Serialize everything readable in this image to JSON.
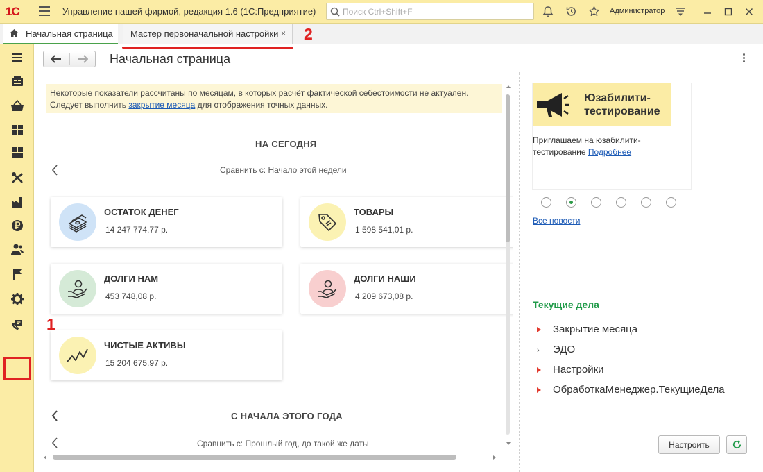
{
  "window": {
    "logo": "1С",
    "title": "Управление нашей фирмой, редакция 1.6  (1С:Предприятие)",
    "search_placeholder": "Поиск Ctrl+Shift+F",
    "user": "Администратор"
  },
  "tabs": [
    {
      "label": "Начальная страница",
      "active": true
    },
    {
      "label": "Мастер первоначальной настройки",
      "close": "×"
    }
  ],
  "annotations": {
    "one": "1",
    "two": "2"
  },
  "page": {
    "title": "Начальная страница"
  },
  "warning": {
    "text1": "Некоторые показатели рассчитаны по месяцам, в которых расчёт фактической себестоимости не актуален.",
    "text2_before": "Следует выполнить ",
    "link": "закрытие месяца",
    "text2_after": " для отображения точных данных."
  },
  "today": {
    "title": "НА СЕГОДНЯ",
    "compare": "Сравнить с: Начало этой недели",
    "cards": [
      {
        "title": "ОСТАТОК ДЕНЕГ",
        "value": "14 247 774,77 р.",
        "color": "#cfe3f7"
      },
      {
        "title": "ТОВАРЫ",
        "value": "1 598 541,01 р.",
        "color": "#fbf2b3"
      },
      {
        "title": "ДОЛГИ НАМ",
        "value": "453 748,08 р.",
        "color": "#d5ead7"
      },
      {
        "title": "ДОЛГИ НАШИ",
        "value": "4 209 673,08 р.",
        "color": "#f8cfcf"
      },
      {
        "title": "ЧИСТЫЕ АКТИВЫ",
        "value": "15 204 675,97 р.",
        "color": "#fbf2b3"
      }
    ]
  },
  "year": {
    "title": "С НАЧАЛА ЭТОГО ГОДА",
    "compare": "Сравнить с: Прошлый год, до такой же даты"
  },
  "news": {
    "title": "Юзабилити-тестирование",
    "body": "Приглашаем на юзабилити-тестирование",
    "link": "Подробнее",
    "all_news": "Все новости",
    "active_dot": 2
  },
  "current_tasks": {
    "title": "Текущие дела",
    "items": [
      {
        "label": "Закрытие месяца",
        "marker": "red-triangle"
      },
      {
        "label": "ЭДО",
        "marker": "chevron"
      },
      {
        "label": "Настройки",
        "marker": "red-triangle"
      },
      {
        "label": "ОбработкаМенеджер.ТекущиеДела",
        "marker": "red-triangle"
      }
    ]
  },
  "buttons": {
    "setup": "Настроить"
  },
  "colors": {
    "panel": "#fbeca5",
    "accent_green": "#1f9a48",
    "annotation_red": "#e02222",
    "link": "#1d5bb6"
  }
}
